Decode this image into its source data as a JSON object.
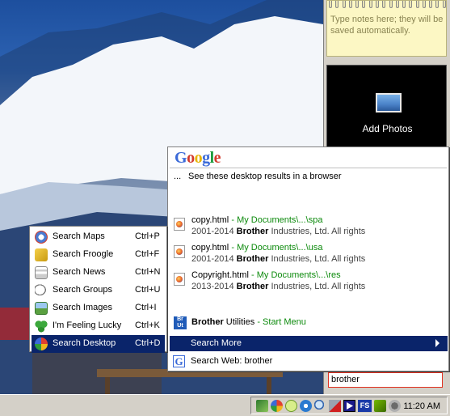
{
  "notes": {
    "text": "Type notes here; they will be saved automatically."
  },
  "photos": {
    "label": "Add Photos"
  },
  "search_box": {
    "value": "brother"
  },
  "google_popup": {
    "logo": {
      "g1": "G",
      "o1": "o",
      "o2": "o",
      "g2": "g",
      "l": "l",
      "e": "e"
    },
    "browser_link": {
      "prefix": "...",
      "text": "See these desktop results in a browser"
    },
    "results": [
      {
        "title": "copy.html",
        "sep": "-",
        "path": "My Documents\\...\\spa",
        "year": "2001-2014",
        "brand": "Brother",
        "rest": "Industries, Ltd. All rights"
      },
      {
        "title": "copy.html",
        "sep": "-",
        "path": "My Documents\\...\\usa",
        "year": "2001-2014",
        "brand": "Brother",
        "rest": "Industries, Ltd. All rights"
      },
      {
        "title": "Copyright.html",
        "sep": "-",
        "path": "My Documents\\...\\res",
        "year": "2013-2014",
        "brand": "Brother",
        "rest": "Industries, Ltd. All rights"
      }
    ],
    "utilities": {
      "brand": "Brother",
      "name": "Utilities",
      "sep": "-",
      "location": "Start Menu"
    },
    "search_more": "Search More",
    "search_web": "Search Web: brother"
  },
  "context_menu": {
    "items": [
      {
        "label": "Search Maps",
        "shortcut": "Ctrl+P",
        "icon": "maps-icon"
      },
      {
        "label": "Search Froogle",
        "shortcut": "Ctrl+F",
        "icon": "froogle-icon"
      },
      {
        "label": "Search News",
        "shortcut": "Ctrl+N",
        "icon": "news-icon"
      },
      {
        "label": "Search Groups",
        "shortcut": "Ctrl+U",
        "icon": "groups-icon"
      },
      {
        "label": "Search Images",
        "shortcut": "Ctrl+I",
        "icon": "images-icon"
      },
      {
        "label": "I'm Feeling Lucky",
        "shortcut": "Ctrl+K",
        "icon": "clover-icon"
      },
      {
        "label": "Search Desktop",
        "shortcut": "Ctrl+D",
        "icon": "google-desktop-icon",
        "selected": true
      }
    ]
  },
  "taskbar": {
    "clock": "11:20 AM",
    "tray_icons": [
      "network-icon",
      "google-desktop-icon",
      "chat-icon",
      "connection-icon",
      "search-icon",
      "security-icon",
      "media-player-icon",
      "fs-icon",
      "nvidia-icon",
      "speaker-icon"
    ],
    "fs_label": "FS"
  }
}
